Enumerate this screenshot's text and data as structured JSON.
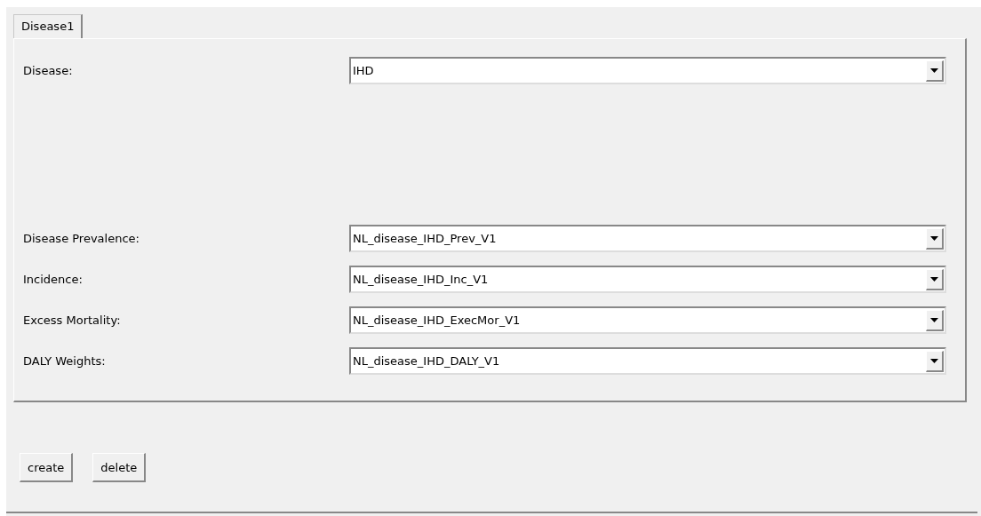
{
  "tabs": [
    {
      "label": "Disease1",
      "selected": true
    }
  ],
  "fields": [
    {
      "label": "Disease:",
      "value": "IHD"
    },
    {
      "label": "Disease Prevalence:",
      "value": "NL_disease_IHD_Prev_V1"
    },
    {
      "label": "Incidence:",
      "value": "NL_disease_IHD_Inc_V1"
    },
    {
      "label": "Excess Mortality:",
      "value": "NL_disease_IHD_ExecMor_V1"
    },
    {
      "label": "DALY Weights:",
      "value": "NL_disease_IHD_DALY_V1"
    }
  ],
  "buttons": [
    "create",
    "delete"
  ]
}
